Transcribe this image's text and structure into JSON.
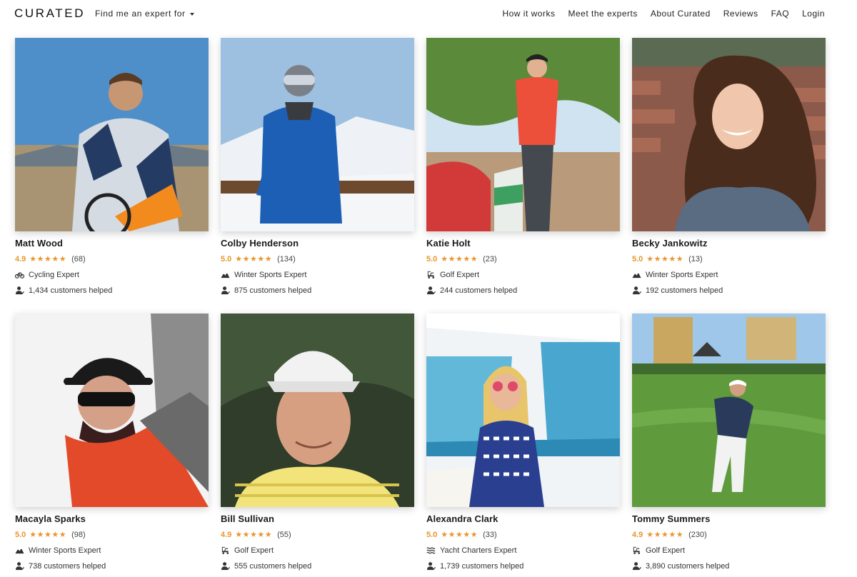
{
  "header": {
    "logo": "CURATED",
    "finder_label": "Find me an expert for",
    "nav": [
      "How it works",
      "Meet the experts",
      "About Curated",
      "Reviews",
      "FAQ",
      "Login"
    ]
  },
  "experts": [
    {
      "name": "Matt Wood",
      "score": "4.9",
      "stars": "★★★★★",
      "reviews": "(68)",
      "specialty": "Cycling Expert",
      "specialty_icon": "bicycle-icon",
      "helped": "1,434 customers helped"
    },
    {
      "name": "Colby Henderson",
      "score": "5.0",
      "stars": "★★★★★",
      "reviews": "(134)",
      "specialty": "Winter Sports Expert",
      "specialty_icon": "mountain-icon",
      "helped": "875 customers helped"
    },
    {
      "name": "Katie Holt",
      "score": "5.0",
      "stars": "★★★★★",
      "reviews": "(23)",
      "specialty": "Golf Expert",
      "specialty_icon": "golf-cart-icon",
      "helped": "244 customers helped"
    },
    {
      "name": "Becky Jankowitz",
      "score": "5.0",
      "stars": "★★★★★",
      "reviews": "(13)",
      "specialty": "Winter Sports Expert",
      "specialty_icon": "mountain-icon",
      "helped": "192 customers helped"
    },
    {
      "name": "Macayla Sparks",
      "score": "5.0",
      "stars": "★★★★★",
      "reviews": "(98)",
      "specialty": "Winter Sports Expert",
      "specialty_icon": "mountain-icon",
      "helped": "738 customers helped"
    },
    {
      "name": "Bill Sullivan",
      "score": "4.9",
      "stars": "★★★★★",
      "reviews": "(55)",
      "specialty": "Golf Expert",
      "specialty_icon": "golf-cart-icon",
      "helped": "555 customers helped"
    },
    {
      "name": "Alexandra Clark",
      "score": "5.0",
      "stars": "★★★★★",
      "reviews": "(33)",
      "specialty": "Yacht Charters Expert",
      "specialty_icon": "waves-icon",
      "helped": "1,739 customers helped"
    },
    {
      "name": "Tommy Summers",
      "score": "4.9",
      "stars": "★★★★★",
      "reviews": "(230)",
      "specialty": "Golf Expert",
      "specialty_icon": "golf-cart-icon",
      "helped": "3,890 customers helped"
    }
  ],
  "colors": {
    "accent": "#e8962c",
    "text": "#222222"
  }
}
